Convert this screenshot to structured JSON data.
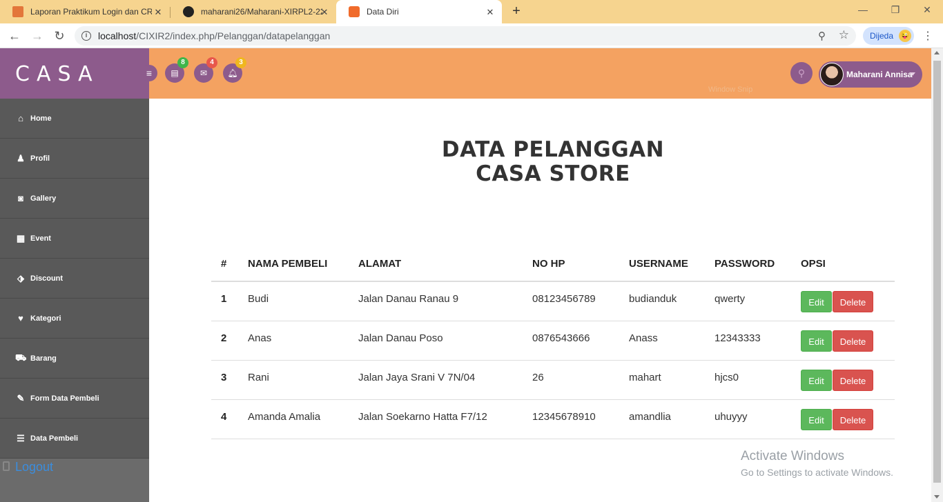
{
  "browser": {
    "tabs": [
      {
        "title": "Laporan Praktikum Login dan CR",
        "icon": "orange-doc-icon",
        "close": "✕"
      },
      {
        "title": "maharani26/Maharani-XIRPL2-22",
        "icon": "github-icon",
        "close": "✕"
      },
      {
        "title": "Data Diri",
        "icon": "xampp-icon",
        "close": "✕"
      }
    ],
    "new_tab": "+",
    "window_controls": {
      "minimize": "—",
      "restore": "❐",
      "close": "✕"
    },
    "url_host": "localhost",
    "url_path": "/CIXIR2/index.php/Pelanggan/datapelanggan",
    "profile_label": "Dijeda",
    "profile_emoji": "😜"
  },
  "app": {
    "brand": "CASA",
    "nav": [
      {
        "label": "Home",
        "icon": "home-icon",
        "glyph": "⌂"
      },
      {
        "label": "Profil",
        "icon": "user-icon",
        "glyph": "♟"
      },
      {
        "label": "Gallery",
        "icon": "camera-icon",
        "glyph": "◙"
      },
      {
        "label": "Event",
        "icon": "gift-icon",
        "glyph": "▦"
      },
      {
        "label": "Discount",
        "icon": "tags-icon",
        "glyph": "⬗"
      },
      {
        "label": "Kategori",
        "icon": "heart-icon",
        "glyph": "♥"
      },
      {
        "label": "Barang",
        "icon": "cart-icon",
        "glyph": "⛟"
      },
      {
        "label": "Form Data Pembeli",
        "icon": "pencil-icon",
        "glyph": "✎"
      },
      {
        "label": "Data Pembeli",
        "icon": "list-icon",
        "glyph": "☰"
      }
    ],
    "logout": "Logout",
    "header": {
      "menu_glyph": "≡",
      "tasks_badge": "8",
      "messages_badge": "4",
      "notifications_badge": "3",
      "user_name": "Maharani Annisa",
      "ghost_text": "Window Snip"
    }
  },
  "main": {
    "title_line1": "DATA PELANGGAN",
    "title_line2": "CASA STORE",
    "columns": [
      "#",
      "NAMA PEMBELI",
      "ALAMAT",
      "NO HP",
      "USERNAME",
      "PASSWORD",
      "OPSI"
    ],
    "rows": [
      {
        "no": "1",
        "nama": "Budi",
        "alamat": "Jalan Danau Ranau 9",
        "hp": "08123456789",
        "username": "budianduk",
        "password": "qwerty"
      },
      {
        "no": "2",
        "nama": "Anas",
        "alamat": "Jalan Danau Poso",
        "hp": "0876543666",
        "username": "Anass",
        "password": "12343333"
      },
      {
        "no": "3",
        "nama": "Rani",
        "alamat": "Jalan Jaya Srani V 7N/04",
        "hp": "26",
        "username": "mahart",
        "password": "hjcs0"
      },
      {
        "no": "4",
        "nama": "Amanda Amalia",
        "alamat": "Jalan Soekarno Hatta F7/12",
        "hp": "12345678910",
        "username": "amandlia",
        "password": "uhuyyy"
      }
    ],
    "edit_label": "Edit",
    "delete_label": "Delete"
  },
  "os": {
    "watermark_title": "Activate Windows",
    "watermark_subtitle": "Go to Settings to activate Windows."
  },
  "colors": {
    "sidebar": "#595959",
    "brand": "#8d5b8c",
    "header": "#f4a261",
    "edit": "#5cb85c",
    "delete": "#d9534f",
    "tab_strip": "#f6d48f"
  }
}
